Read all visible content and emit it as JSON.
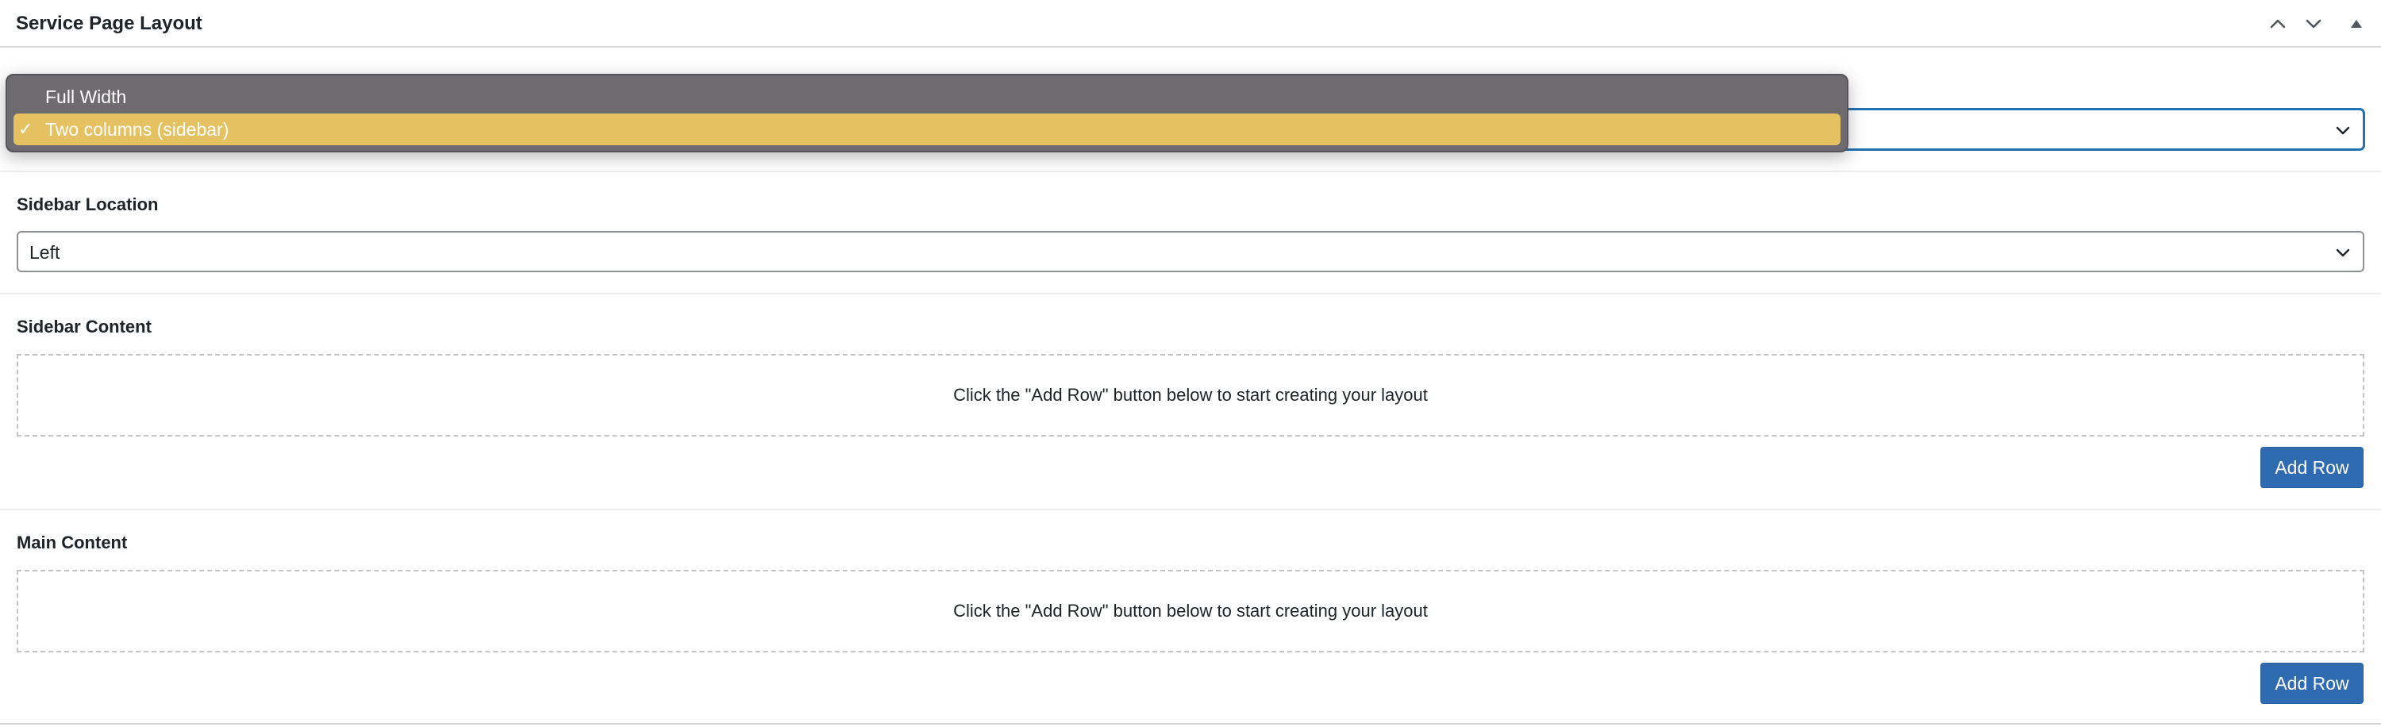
{
  "postbox": {
    "title": "Service Page Layout",
    "controls": [
      "chevron-up-icon",
      "chevron-down-icon",
      "triangle-up-icon"
    ]
  },
  "layout_field": {
    "options": [
      {
        "label": "Full Width",
        "selected": false
      },
      {
        "label": "Two columns (sidebar)",
        "selected": true
      }
    ],
    "checkmark": "✓"
  },
  "sidebar_location": {
    "label": "Sidebar Location",
    "value": "Left"
  },
  "sidebar_content": {
    "label": "Sidebar Content",
    "empty_message": "Click the \"Add Row\" button below to start creating your layout",
    "add_button": "Add Row"
  },
  "main_content": {
    "label": "Main Content",
    "empty_message": "Click the \"Add Row\" button below to start creating your layout",
    "add_button": "Add Row"
  },
  "colors": {
    "accent": "#2271b1",
    "button": "#2f6bb0",
    "selected_option": "#e6c161",
    "menu_background": "#6d6b70"
  }
}
